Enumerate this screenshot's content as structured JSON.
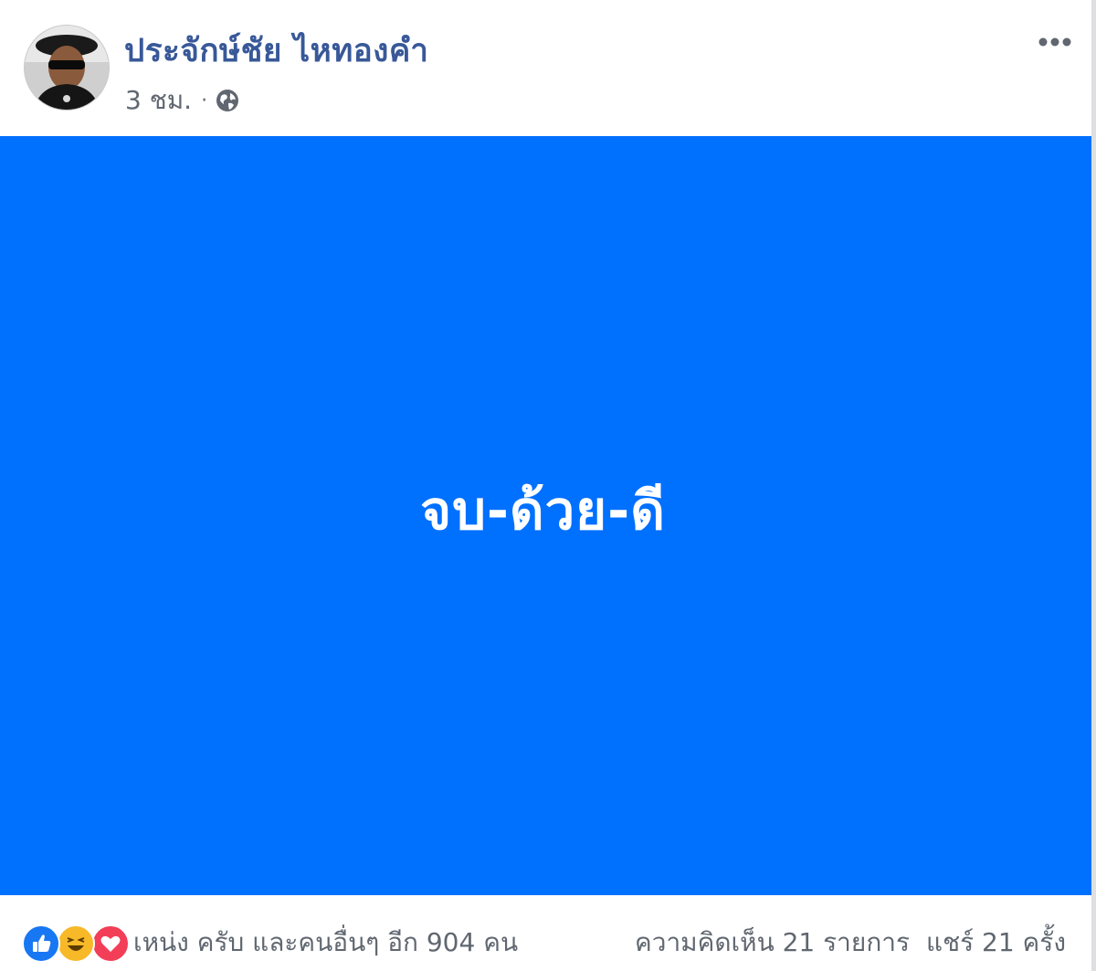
{
  "post": {
    "author": "ประจักษ์ชัย ไหทองคำ",
    "time": "3 ชม.",
    "separator": "·",
    "privacy_icon": "globe-icon",
    "more_icon": "more-options-icon",
    "content_text": "จบ-ด้วย-ดี",
    "content_background": "#0070ff"
  },
  "footer": {
    "reaction_icons": [
      "like-icon",
      "haha-icon",
      "love-icon"
    ],
    "reaction_summary": "เหน่ง ครับ และคนอื่นๆ อีก 904 คน",
    "comments": "ความคิดเห็น 21 รายการ",
    "shares": "แชร์ 21 ครั้ง"
  },
  "colors": {
    "author_link": "#385898",
    "muted_text": "#606770",
    "like": "#1877f2",
    "haha": "#f7b928",
    "love": "#f33e58"
  }
}
